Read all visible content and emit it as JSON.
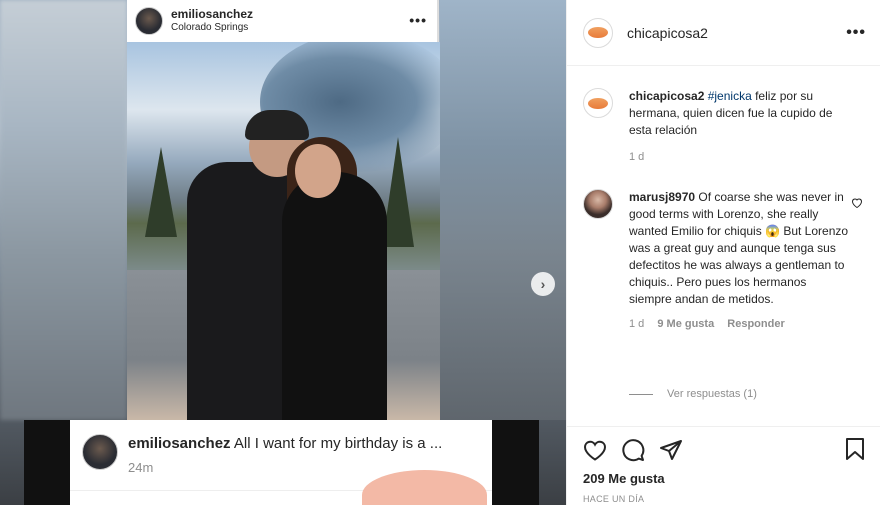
{
  "post_overlay": {
    "username": "emiliosanchez",
    "location": "Colorado Springs",
    "menu_icon": "more-dots-icon"
  },
  "story_card": {
    "username": "emiliosanchez",
    "text": "All I want for my birthday is a ...",
    "time": "24m"
  },
  "panel": {
    "header": {
      "username": "chicapicosa2",
      "menu_icon": "more-dots-icon"
    },
    "caption": {
      "username": "chicapicosa2",
      "hashtag": "#jenicka",
      "text": " feliz por su hermana, quien dicen fue la cupido de esta relación",
      "time": "1 d"
    },
    "comment": {
      "username": "marusj8970",
      "text": " Of coarse she was never in good terms with Lorenzo, she really wanted Emilio for chiquis 😱 But Lorenzo was a great guy and aunque tenga sus defectitos he was always a gentleman to chiquis.. Pero pues los hermanos siempre andan de metidos.",
      "time": "1 d",
      "likes": "9 Me gusta",
      "reply": "Responder"
    },
    "view_replies": "Ver respuestas (1)",
    "likes_count": "209 Me gusta",
    "posted_ago": "HACE UN DÍA"
  }
}
